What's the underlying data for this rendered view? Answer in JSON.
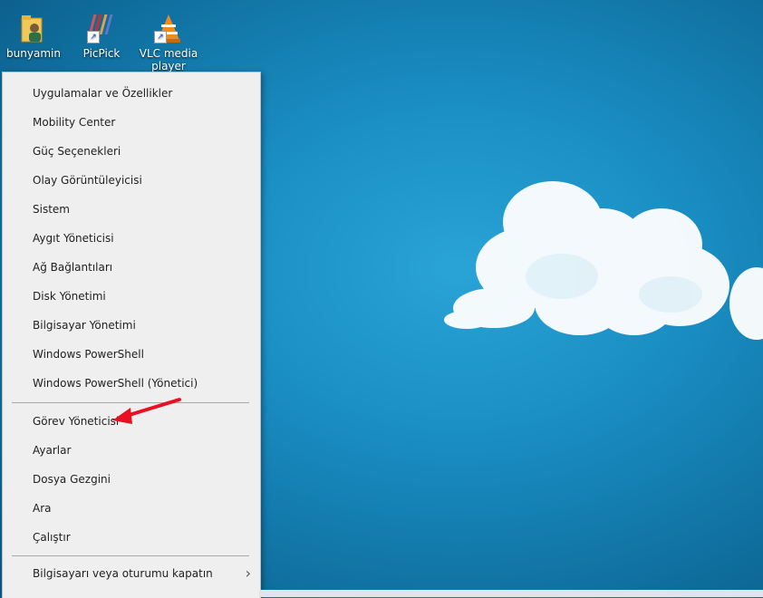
{
  "desktop": {
    "icons": [
      {
        "label": "bunyamin",
        "icon": "user-folder-icon"
      },
      {
        "label": "PicPick",
        "icon": "picpick-icon"
      },
      {
        "label": "VLC media player",
        "icon": "vlc-cone-icon"
      }
    ]
  },
  "menu": {
    "items": [
      "Uygulamalar ve Özellikler",
      "Mobility Center",
      "Güç Seçenekleri",
      "Olay Görüntüleyicisi",
      "Sistem",
      "Aygıt Yöneticisi",
      "Ağ Bağlantıları",
      "Disk Yönetimi",
      "Bilgisayar Yönetimi",
      "Windows PowerShell",
      "Windows PowerShell (Yönetici)",
      "Görev Yöneticisi",
      "Ayarlar",
      "Dosya Gezgini",
      "Ara",
      "Çalıştır",
      "Bilgisayarı veya oturumu kapatın"
    ],
    "submenu_icon": "chevron-right-icon",
    "highlight_color": "#e81123"
  }
}
